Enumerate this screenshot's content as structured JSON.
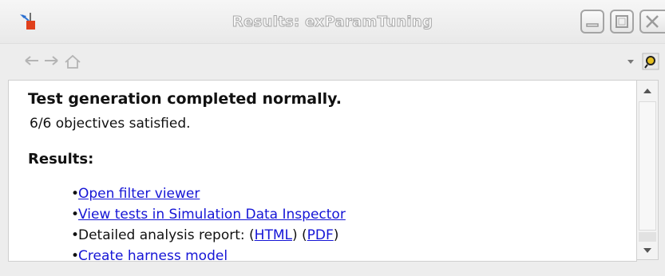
{
  "window": {
    "title": "Results: exParamTuning"
  },
  "content": {
    "heading": "Test generation completed normally.",
    "summary": "6/6 objectives satisfied.",
    "results_heading": "Results:",
    "items": [
      {
        "link": "Open filter viewer"
      },
      {
        "link": "View tests in Simulation Data Inspector"
      },
      {
        "prefix": "Detailed analysis report: (",
        "link_html": "HTML",
        "middle": ") (",
        "link_pdf": "PDF",
        "suffix": ")"
      },
      {
        "link": "Create harness model"
      }
    ]
  },
  "colors": {
    "link": "#1515d6",
    "title_text": "#f8f8f8",
    "icon_red": "#e0401c",
    "icon_blue": "#2a6fd0"
  },
  "icons": [
    "simulink-app-icon",
    "back-arrow-icon",
    "forward-arrow-icon",
    "home-icon",
    "dropdown-arrow-icon",
    "dock-pin-icon",
    "minimize-icon",
    "maximize-icon",
    "close-icon",
    "scroll-up-icon",
    "scroll-down-icon"
  ]
}
